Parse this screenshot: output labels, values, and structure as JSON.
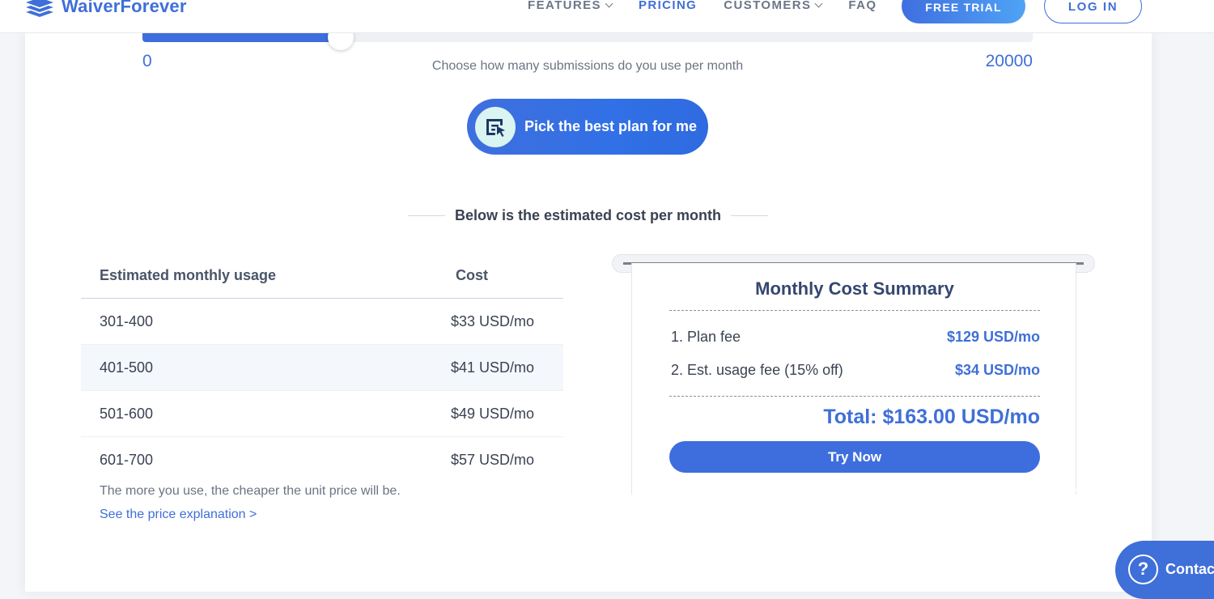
{
  "header": {
    "brand": "WaiverForever",
    "nav": [
      {
        "label": "FEATURES",
        "has_dropdown": true,
        "active": false
      },
      {
        "label": "PRICING",
        "has_dropdown": false,
        "active": true
      },
      {
        "label": "CUSTOMERS",
        "has_dropdown": true,
        "active": false
      },
      {
        "label": "FAQ",
        "has_dropdown": false,
        "active": false
      }
    ],
    "free_trial": "FREE TRIAL",
    "login": "LOG IN"
  },
  "slider": {
    "min": "0",
    "max": "20000",
    "fill_fraction": 0.223,
    "caption": "Choose how many submissions do you use per month"
  },
  "pick_plan": {
    "label": "Pick the best plan for me",
    "icon": "plan-select-icon"
  },
  "estimate_heading": "Below is the estimated cost per month",
  "usage_table": {
    "headers": [
      "Estimated monthly usage",
      "Cost"
    ],
    "rows": [
      {
        "usage": "301-400",
        "cost": "$33 USD/mo"
      },
      {
        "usage": "401-500",
        "cost": "$41 USD/mo"
      },
      {
        "usage": "501-600",
        "cost": "$49 USD/mo"
      },
      {
        "usage": "601-700",
        "cost": "$57 USD/mo"
      }
    ],
    "note": "The more you use, the cheaper the unit price will be.",
    "link": "See the price explanation >"
  },
  "summary": {
    "title": "Monthly Cost Summary",
    "plan_fee_label": "1. Plan fee",
    "plan_fee_value": "$129 USD/mo",
    "usage_fee_label": "2. Est. usage fee (15% off)",
    "usage_fee_value": "$34 USD/mo",
    "total": "Total: $163.00 USD/mo",
    "cta": "Try Now"
  },
  "contact": {
    "label": "Contac",
    "icon": "help-question-icon"
  },
  "colors": {
    "accent": "#3f6fd8",
    "button": "#3e6ede",
    "page_bg": "#f4f5f8",
    "alt_row": "#f4f7fc"
  }
}
